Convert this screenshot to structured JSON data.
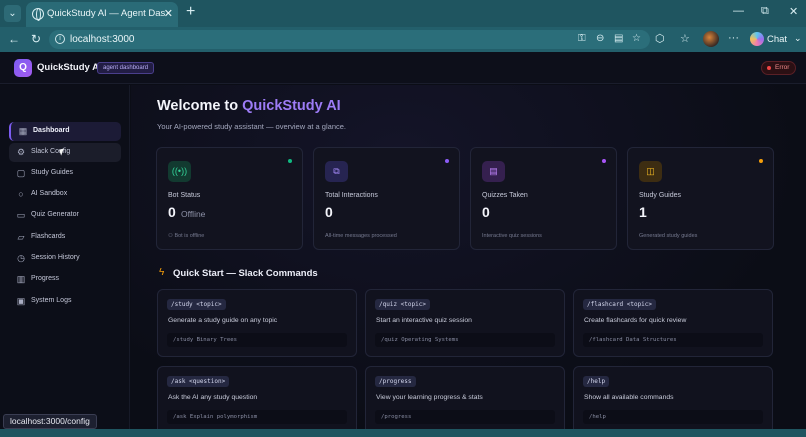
{
  "browser": {
    "tab_title": "QuickStudy AI — Agent Dashboard",
    "url": "localhost:3000",
    "chat_label": "Chat",
    "status_url": "localhost:3000/config"
  },
  "header": {
    "logo_letter": "Q",
    "app_name": "QuickStudy AI",
    "badge": "agent dashboard",
    "error_label": "Error"
  },
  "sidebar": {
    "items": [
      {
        "label": "Dashboard",
        "icon": "grid-icon"
      },
      {
        "label": "Slack Config",
        "icon": "gear-icon"
      },
      {
        "label": "Study Guides",
        "icon": "book-icon"
      },
      {
        "label": "AI Sandbox",
        "icon": "chat-bubble-icon"
      },
      {
        "label": "Quiz Generator",
        "icon": "clipboard-icon"
      },
      {
        "label": "Flashcards",
        "icon": "cards-icon"
      },
      {
        "label": "Session History",
        "icon": "clock-icon"
      },
      {
        "label": "Progress",
        "icon": "bar-chart-icon"
      },
      {
        "label": "System Logs",
        "icon": "terminal-icon"
      }
    ]
  },
  "main": {
    "welcome_prefix": "Welcome to ",
    "welcome_accent": "QuickStudy AI",
    "subtitle": "Your AI-powered study assistant — overview at a glance.",
    "stats": [
      {
        "label": "Bot Status",
        "value": "0",
        "sub": "Offline",
        "foot": "⚇ Bot is offline",
        "icon": "broadcast-icon",
        "accent": "#10b981"
      },
      {
        "label": "Total Interactions",
        "value": "0",
        "sub": "",
        "foot": "All-time messages processed",
        "icon": "messages-icon",
        "accent": "#8b5cf6"
      },
      {
        "label": "Quizzes Taken",
        "value": "0",
        "sub": "",
        "foot": "Interactive quiz sessions",
        "icon": "clipboard-icon",
        "accent": "#a855f7"
      },
      {
        "label": "Study Guides",
        "value": "1",
        "sub": "",
        "foot": "Generated study guides",
        "icon": "book-icon",
        "accent": "#f59e0b"
      }
    ],
    "quick_start_title": "Quick Start — Slack Commands",
    "commands": [
      {
        "cmd": "/study <topic>",
        "desc": "Generate a study guide on any topic",
        "example": "/study Binary Trees"
      },
      {
        "cmd": "/quiz <topic>",
        "desc": "Start an interactive quiz session",
        "example": "/quiz Operating Systems"
      },
      {
        "cmd": "/flashcard <topic>",
        "desc": "Create flashcards for quick review",
        "example": "/flashcard Data Structures"
      },
      {
        "cmd": "/ask <question>",
        "desc": "Ask the AI any study question",
        "example": "/ask Explain polymorphism"
      },
      {
        "cmd": "/progress",
        "desc": "View your learning progress & stats",
        "example": "/progress"
      },
      {
        "cmd": "/help",
        "desc": "Show all available commands",
        "example": "/help"
      }
    ]
  }
}
